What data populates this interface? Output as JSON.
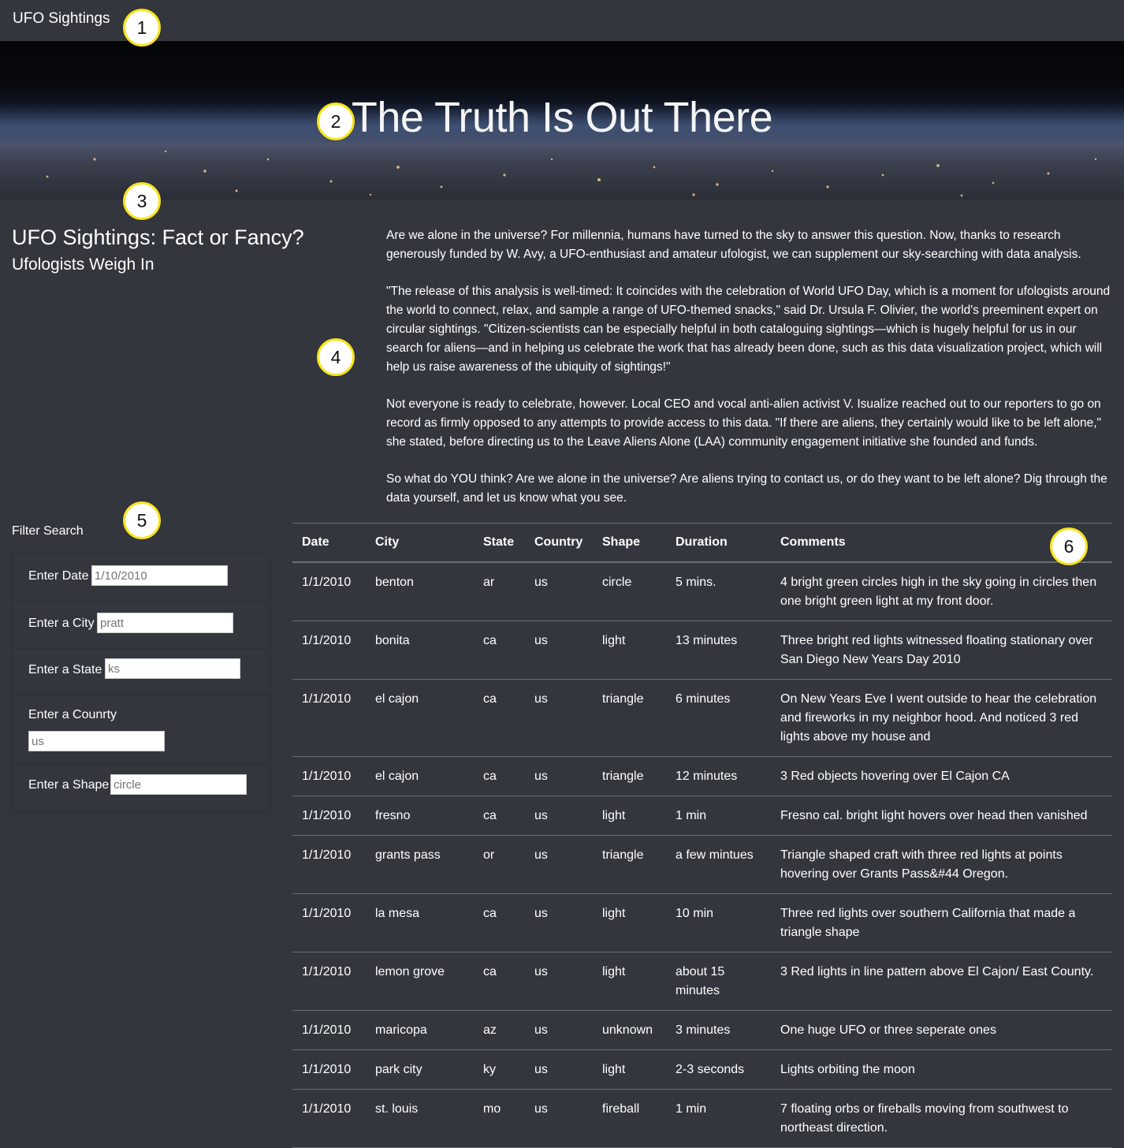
{
  "navbar": {
    "brand": "UFO Sightings"
  },
  "hero": {
    "title": "The Truth Is Out There"
  },
  "main": {
    "title": "UFO Sightings: Fact or Fancy?",
    "subtitle": "Ufologists Weigh In"
  },
  "article": {
    "paragraphs": [
      "Are we alone in the universe? For millennia, humans have turned to the sky to answer this question. Now, thanks to research generously funded by W. Avy, a UFO-enthusiast and amateur ufologist, we can supplement our sky-searching with data analysis.",
      "\"The release of this analysis is well-timed: It coincides with the celebration of World UFO Day, which is a moment for ufologists around the world to connect, relax, and sample a range of UFO-themed snacks,\" said Dr. Ursula F. Olivier, the world's preeminent expert on circular sightings. \"Citizen-scientists can be especially helpful in both cataloguing sightings—which is hugely helpful for us in our search for aliens—and in helping us celebrate the work that has already been done, such as this data visualization project, which will help us raise awareness of the ubiquity of sightings!\"",
      "Not everyone is ready to celebrate, however. Local CEO and vocal anti-alien activist V. Isualize reached out to our reporters to go on record as firmly opposed to any attempts to provide access to this data. \"If there are aliens, they certainly would like to be left alone,\" she stated, before directing us to the Leave Aliens Alone (LAA) community engagement initiative she founded and funds.",
      "So what do YOU think? Are we alone in the universe? Are aliens trying to contact us, or do they want to be left alone? Dig through the data yourself, and let us know what you see."
    ]
  },
  "filters": {
    "heading": "Filter Search",
    "items": [
      {
        "label": "Enter Date",
        "placeholder": "1/10/2010"
      },
      {
        "label": "Enter a City",
        "placeholder": "pratt"
      },
      {
        "label": "Enter a State",
        "placeholder": "ks"
      },
      {
        "label": "Enter a Counrty",
        "placeholder": "us"
      },
      {
        "label": "Enter a Shape",
        "placeholder": "circle"
      }
    ]
  },
  "table": {
    "headers": [
      "Date",
      "City",
      "State",
      "Country",
      "Shape",
      "Duration",
      "Comments"
    ],
    "rows": [
      [
        "1/1/2010",
        "benton",
        "ar",
        "us",
        "circle",
        "5 mins.",
        "4 bright green circles high in the sky going in circles then one bright green light at my front door."
      ],
      [
        "1/1/2010",
        "bonita",
        "ca",
        "us",
        "light",
        "13 minutes",
        "Three bright red lights witnessed floating stationary over San Diego New Years Day 2010"
      ],
      [
        "1/1/2010",
        "el cajon",
        "ca",
        "us",
        "triangle",
        "6 minutes",
        "On New Years Eve I went outside to hear the celebration and fireworks in my neighbor hood. And noticed 3 red lights above my house and"
      ],
      [
        "1/1/2010",
        "el cajon",
        "ca",
        "us",
        "triangle",
        "12 minutes",
        "3 Red objects hovering over El Cajon CA"
      ],
      [
        "1/1/2010",
        "fresno",
        "ca",
        "us",
        "light",
        "1 min",
        "Fresno cal. bright light hovers over head then vanished"
      ],
      [
        "1/1/2010",
        "grants pass",
        "or",
        "us",
        "triangle",
        "a few mintues",
        "Triangle shaped craft with three red lights at points hovering over Grants Pass&#44 Oregon."
      ],
      [
        "1/1/2010",
        "la mesa",
        "ca",
        "us",
        "light",
        "10 min",
        "Three red lights over southern California that made a triangle shape"
      ],
      [
        "1/1/2010",
        "lemon grove",
        "ca",
        "us",
        "light",
        "about 15 minutes",
        "3 Red lights in line pattern above El Cajon/ East County."
      ],
      [
        "1/1/2010",
        "maricopa",
        "az",
        "us",
        "unknown",
        "3 minutes",
        "One huge UFO or three seperate ones"
      ],
      [
        "1/1/2010",
        "park city",
        "ky",
        "us",
        "light",
        "2-3 seconds",
        "Lights orbiting the moon"
      ],
      [
        "1/1/2010",
        "st. louis",
        "mo",
        "us",
        "fireball",
        "1 min",
        "7 floating orbs or fireballs moving from southwest to northeast direction."
      ]
    ]
  },
  "annotations": [
    "1",
    "2",
    "3",
    "4",
    "5",
    "6"
  ]
}
